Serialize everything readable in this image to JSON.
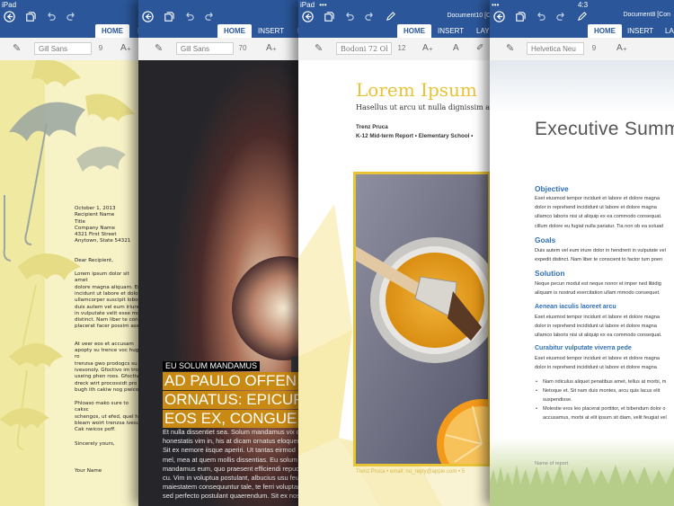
{
  "status": {
    "device": "iPad",
    "signal": "•••",
    "time": "4:3"
  },
  "docs": [
    {
      "font": "Gill Sans",
      "size": "9",
      "size_glyph": "A₊",
      "tabs": [
        "HOME",
        "IN"
      ],
      "letter": {
        "date": "October 1, 2013",
        "address": [
          "Recipient Name",
          "Title",
          "Company Name",
          "4321 First Street",
          "Anytown, State 54321"
        ],
        "salutation": "Dear Recipient,",
        "para1": [
          "Lorem ipsum dolor sit amet",
          "dolore magna aliquam. Er",
          "incidunt ut labore et dolor",
          "ullamcorper suscipit lobor",
          "duis autem vel eum iriure",
          "in vulputate velit esse mo",
          "distinct. Nam liber te con",
          "placerat facer possim assu"
        ],
        "para2": [
          "At veer eos et accusam",
          "apopty su trence voc hugh ro",
          "trenzsa gwo prodogcs su ik",
          "ivesonoly. Gfoctivo im tros",
          "useing phen roos. Gfoctivo",
          "dreck wirt procossidt pro",
          "bugh ith cakiw nog pwicos"
        ],
        "para3": [
          "Phloaso mako sure to caksc",
          "schengos, ut efed, quel ha",
          "bleam woirt trenzsa ivesu",
          "Cak nwicos poff."
        ],
        "closing": "Sincerely yours,",
        "name": "Your Name"
      }
    },
    {
      "font": "Gill Sans",
      "size": "70",
      "size_glyph": "A₊",
      "tabs": [
        "HOME",
        "INSERT",
        "LA"
      ],
      "kicker": "EU SOLUM MANDAMUS",
      "headline": [
        "AD PAULO OFFEN",
        "ORNATUS: EPICUR",
        "EOS EX, CONGUE"
      ],
      "body": [
        "Et nulla dissentiet sea. Solum mandamus vix cu,",
        "honestatis vim in, his at dicam ornatus eloquentiam.",
        "Sit ex nemore iisque aperiri. Ut tantas eirmod",
        "mel, mea at quem mollis dissentias. Eu solum",
        "mandamus eum, quo praesent efficiendi repudiare",
        "cu. Vim in voluptua postulant, albucius usu feugait",
        "maiestatem consequuntur tale, te ferri voluptaria",
        "sed perfecto postulant quaerendum. Sit ex noster"
      ]
    },
    {
      "font": "Bodoni 72 Ol",
      "size": "12",
      "size_glyph": "A₊",
      "b_glyph": "A",
      "tabs": [
        "HOME",
        "INSERT",
        "LAYO"
      ],
      "title_bar": "Document10 [Co",
      "title": "Lorem Ipsum",
      "subtitle": "Hasellus ut arcu ut nulla dignissim aucto",
      "author": "Trenz Pruca",
      "meta": "K-12 Mid-term Report  •  Elementary School  •",
      "footer": "Trenz Pruca  •  email: no_reply@apple.com  •  5"
    },
    {
      "font": "Helvetica Neu",
      "size": "9",
      "size_glyph": "A₊",
      "tabs": [
        "HOME",
        "INSERT",
        "LA"
      ],
      "title_bar": "Document8 [Con",
      "title": "Executive Summ",
      "objective_h": "Objective",
      "objective": [
        "Eset eiusmod tempor incidunt et labore et dolore magna",
        "dolor in reprehend incididunt ut labore et dolore magna",
        "ullamco laboris nisi ut aliquip ex ea commodo consequat.",
        "cillum dolore eu fugiat nulla pariatur. Tia non ob ea soluad"
      ],
      "goals_h": "Goals",
      "goals": [
        "Duis autem vel eum iriure dolor in hendrerit in vulputate vel",
        "expedit distinct. Nam liber te conscient to factor tum poen"
      ],
      "solution_h": "Solution",
      "solution": [
        "Neque pecun modut est neque nonor et imper ned libidig",
        "aliquam is nostrud exercitation ullam mmodo consequet."
      ],
      "sub1_h": "Aenean iaculis laoreet arcu",
      "sub1": [
        "Eset eiusmod tempor incidunt et labore et dolore magna",
        "dolor in reprehend incididunt ut labore et dolore magna",
        "ullamco laboris nisi ut aliquip ex ea commodo consequat."
      ],
      "sub2_h": "Curabitur vulputate viverra pede",
      "sub2": [
        "Eset eiusmod tempor incidunt et labore et dolore magna",
        "dolor in reprehend incididunt ut labore et dolore magna"
      ],
      "bullets": [
        [
          "Nam ridiculus aliquet penatibus amet, tellus at morbi, m"
        ],
        [
          "Netoque et. Sit nam duis montes, arcu quis lacus elit",
          "suspendisse."
        ],
        [
          "Molestie eros leo placerat porttitor, et bibendum dolor o",
          "accusamus, morbi at elit ipsum sit diam, velit feugiat vel"
        ]
      ],
      "footer": "Name of report"
    }
  ],
  "colors": {
    "accent": "#2b579a",
    "doc3_title": "#e7c335",
    "doc4_heading": "#2f6fb5"
  }
}
